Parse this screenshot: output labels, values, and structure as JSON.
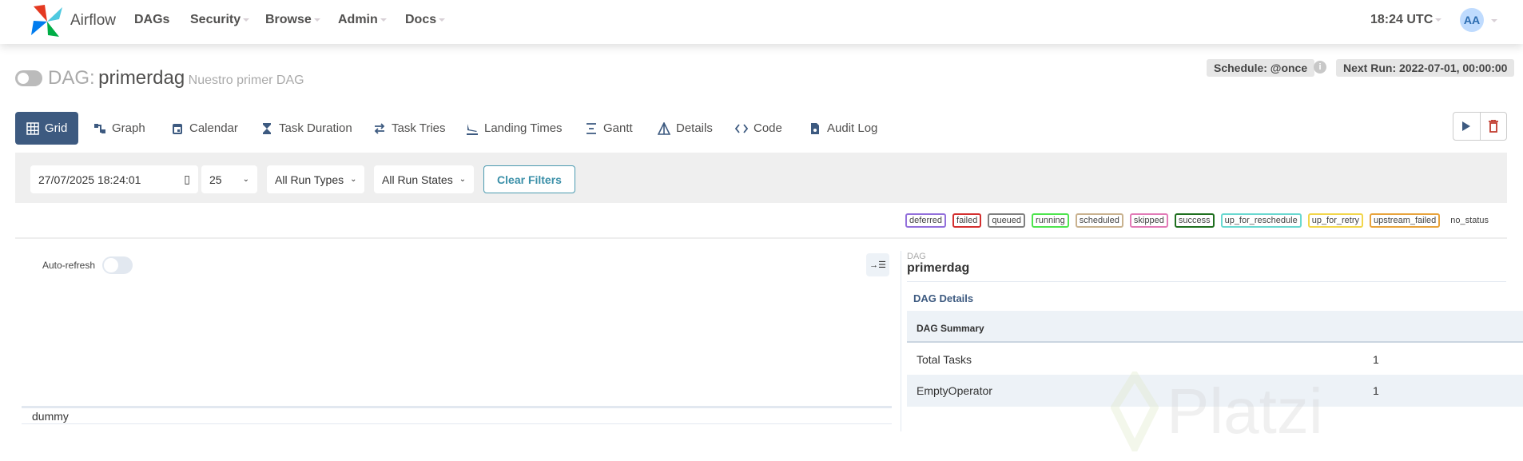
{
  "nav": {
    "brand": "Airflow",
    "links": [
      {
        "label": "DAGs",
        "caret": false
      },
      {
        "label": "Security",
        "caret": true
      },
      {
        "label": "Browse",
        "caret": true
      },
      {
        "label": "Admin",
        "caret": true
      },
      {
        "label": "Docs",
        "caret": true
      }
    ],
    "time": "18:24 UTC",
    "avatar": "AA"
  },
  "header": {
    "prefix": "DAG:",
    "dag_id": "primerdag",
    "description": "Nuestro primer DAG",
    "schedule": "Schedule: @once",
    "next_run": "Next Run: 2022-07-01, 00:00:00"
  },
  "tabs": [
    {
      "label": "Grid",
      "icon": "grid-icon",
      "active": true
    },
    {
      "label": "Graph",
      "icon": "graph-icon"
    },
    {
      "label": "Calendar",
      "icon": "calendar-icon"
    },
    {
      "label": "Task Duration",
      "icon": "hourglass-icon"
    },
    {
      "label": "Task Tries",
      "icon": "retry-icon"
    },
    {
      "label": "Landing Times",
      "icon": "landing-icon"
    },
    {
      "label": "Gantt",
      "icon": "gantt-icon"
    },
    {
      "label": "Details",
      "icon": "details-icon"
    },
    {
      "label": "Code",
      "icon": "code-icon"
    },
    {
      "label": "Audit Log",
      "icon": "audit-log-icon"
    }
  ],
  "filters": {
    "date": "27/07/2025 18:24:01",
    "num_runs": "25",
    "run_types": "All Run Types",
    "run_states": "All Run States",
    "clear": "Clear Filters"
  },
  "legend": [
    {
      "label": "deferred",
      "color": "#9370db"
    },
    {
      "label": "failed",
      "color": "#d32f2f"
    },
    {
      "label": "queued",
      "color": "#808080"
    },
    {
      "label": "running",
      "color": "#4ee44e"
    },
    {
      "label": "scheduled",
      "color": "#c9b28f"
    },
    {
      "label": "skipped",
      "color": "#e27bb7"
    },
    {
      "label": "success",
      "color": "#1f6f1f"
    },
    {
      "label": "up_for_reschedule",
      "color": "#6ad8d0"
    },
    {
      "label": "up_for_retry",
      "color": "#f2d64b"
    },
    {
      "label": "upstream_failed",
      "color": "#e8a33c"
    },
    {
      "label": "no_status",
      "color": ""
    }
  ],
  "grid": {
    "auto_refresh": "Auto-refresh",
    "tasks": [
      "dummy"
    ]
  },
  "details": {
    "kicker": "DAG",
    "dag_id": "primerdag",
    "tab": "DAG Details",
    "summary_header": "DAG Summary",
    "rows": [
      {
        "label": "Total Tasks",
        "value": "1"
      },
      {
        "label": "EmptyOperator",
        "value": "1"
      }
    ]
  },
  "watermark": "Platzi"
}
